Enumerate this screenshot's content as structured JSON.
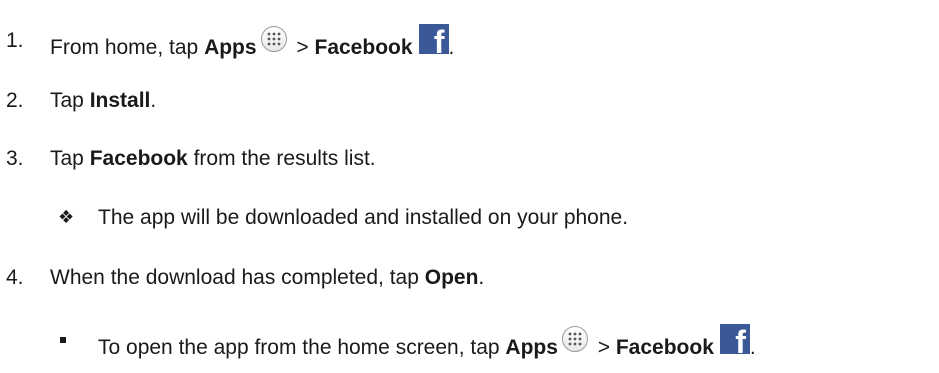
{
  "steps": [
    {
      "num": "1.",
      "pre": "From home, tap ",
      "bold1": "Apps",
      "sep": " > ",
      "bold2": "Facebook",
      "post": "."
    },
    {
      "num": "2.",
      "pre": "Tap ",
      "bold": "Install",
      "post": "."
    },
    {
      "num": "3.",
      "pre": "Tap ",
      "bold": "Facebook",
      "post": " from the results list."
    },
    {
      "num": "4.",
      "pre": "When the download has completed, tap ",
      "bold": "Open",
      "post": "."
    }
  ],
  "note": {
    "bullet": "❖",
    "text": "The app will be downloaded and installed on your phone."
  },
  "tip": {
    "pre": "To open the app from the home screen, tap ",
    "bold1": "Apps",
    "sep": " > ",
    "bold2": "Facebook",
    "post": "."
  },
  "icons": {
    "apps": "apps-grid-icon",
    "facebook": "facebook-icon",
    "facebook_letter": "f",
    "facebook_color": "#3b5998"
  }
}
